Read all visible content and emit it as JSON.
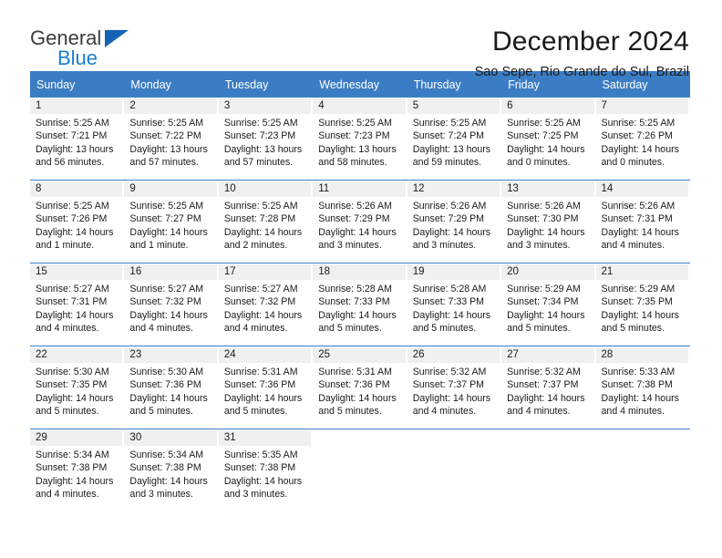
{
  "brand": {
    "name_part1": "General",
    "name_part2": "Blue",
    "triangle_color": "#1464b4",
    "blue_color": "#1a7fd4"
  },
  "header": {
    "title": "December 2024",
    "location": "Sao Sepe, Rio Grande do Sul, Brazil"
  },
  "theme": {
    "header_row_bg": "#3b7dc4",
    "daynum_band_bg": "#f0f0f0",
    "row_separator": "#3b7dc4",
    "text_color": "#1a1a1a"
  },
  "weekdays": [
    "Sunday",
    "Monday",
    "Tuesday",
    "Wednesday",
    "Thursday",
    "Friday",
    "Saturday"
  ],
  "labels": {
    "sunrise_prefix": "Sunrise:",
    "sunset_prefix": "Sunset:",
    "daylight_prefix": "Daylight:"
  },
  "weeks": [
    [
      {
        "day": "1",
        "sunrise": "Sunrise: 5:25 AM",
        "sunset": "Sunset: 7:21 PM",
        "daylight_line1": "Daylight: 13 hours",
        "daylight_line2": "and 56 minutes."
      },
      {
        "day": "2",
        "sunrise": "Sunrise: 5:25 AM",
        "sunset": "Sunset: 7:22 PM",
        "daylight_line1": "Daylight: 13 hours",
        "daylight_line2": "and 57 minutes."
      },
      {
        "day": "3",
        "sunrise": "Sunrise: 5:25 AM",
        "sunset": "Sunset: 7:23 PM",
        "daylight_line1": "Daylight: 13 hours",
        "daylight_line2": "and 57 minutes."
      },
      {
        "day": "4",
        "sunrise": "Sunrise: 5:25 AM",
        "sunset": "Sunset: 7:23 PM",
        "daylight_line1": "Daylight: 13 hours",
        "daylight_line2": "and 58 minutes."
      },
      {
        "day": "5",
        "sunrise": "Sunrise: 5:25 AM",
        "sunset": "Sunset: 7:24 PM",
        "daylight_line1": "Daylight: 13 hours",
        "daylight_line2": "and 59 minutes."
      },
      {
        "day": "6",
        "sunrise": "Sunrise: 5:25 AM",
        "sunset": "Sunset: 7:25 PM",
        "daylight_line1": "Daylight: 14 hours",
        "daylight_line2": "and 0 minutes."
      },
      {
        "day": "7",
        "sunrise": "Sunrise: 5:25 AM",
        "sunset": "Sunset: 7:26 PM",
        "daylight_line1": "Daylight: 14 hours",
        "daylight_line2": "and 0 minutes."
      }
    ],
    [
      {
        "day": "8",
        "sunrise": "Sunrise: 5:25 AM",
        "sunset": "Sunset: 7:26 PM",
        "daylight_line1": "Daylight: 14 hours",
        "daylight_line2": "and 1 minute."
      },
      {
        "day": "9",
        "sunrise": "Sunrise: 5:25 AM",
        "sunset": "Sunset: 7:27 PM",
        "daylight_line1": "Daylight: 14 hours",
        "daylight_line2": "and 1 minute."
      },
      {
        "day": "10",
        "sunrise": "Sunrise: 5:25 AM",
        "sunset": "Sunset: 7:28 PM",
        "daylight_line1": "Daylight: 14 hours",
        "daylight_line2": "and 2 minutes."
      },
      {
        "day": "11",
        "sunrise": "Sunrise: 5:26 AM",
        "sunset": "Sunset: 7:29 PM",
        "daylight_line1": "Daylight: 14 hours",
        "daylight_line2": "and 3 minutes."
      },
      {
        "day": "12",
        "sunrise": "Sunrise: 5:26 AM",
        "sunset": "Sunset: 7:29 PM",
        "daylight_line1": "Daylight: 14 hours",
        "daylight_line2": "and 3 minutes."
      },
      {
        "day": "13",
        "sunrise": "Sunrise: 5:26 AM",
        "sunset": "Sunset: 7:30 PM",
        "daylight_line1": "Daylight: 14 hours",
        "daylight_line2": "and 3 minutes."
      },
      {
        "day": "14",
        "sunrise": "Sunrise: 5:26 AM",
        "sunset": "Sunset: 7:31 PM",
        "daylight_line1": "Daylight: 14 hours",
        "daylight_line2": "and 4 minutes."
      }
    ],
    [
      {
        "day": "15",
        "sunrise": "Sunrise: 5:27 AM",
        "sunset": "Sunset: 7:31 PM",
        "daylight_line1": "Daylight: 14 hours",
        "daylight_line2": "and 4 minutes."
      },
      {
        "day": "16",
        "sunrise": "Sunrise: 5:27 AM",
        "sunset": "Sunset: 7:32 PM",
        "daylight_line1": "Daylight: 14 hours",
        "daylight_line2": "and 4 minutes."
      },
      {
        "day": "17",
        "sunrise": "Sunrise: 5:27 AM",
        "sunset": "Sunset: 7:32 PM",
        "daylight_line1": "Daylight: 14 hours",
        "daylight_line2": "and 4 minutes."
      },
      {
        "day": "18",
        "sunrise": "Sunrise: 5:28 AM",
        "sunset": "Sunset: 7:33 PM",
        "daylight_line1": "Daylight: 14 hours",
        "daylight_line2": "and 5 minutes."
      },
      {
        "day": "19",
        "sunrise": "Sunrise: 5:28 AM",
        "sunset": "Sunset: 7:33 PM",
        "daylight_line1": "Daylight: 14 hours",
        "daylight_line2": "and 5 minutes."
      },
      {
        "day": "20",
        "sunrise": "Sunrise: 5:29 AM",
        "sunset": "Sunset: 7:34 PM",
        "daylight_line1": "Daylight: 14 hours",
        "daylight_line2": "and 5 minutes."
      },
      {
        "day": "21",
        "sunrise": "Sunrise: 5:29 AM",
        "sunset": "Sunset: 7:35 PM",
        "daylight_line1": "Daylight: 14 hours",
        "daylight_line2": "and 5 minutes."
      }
    ],
    [
      {
        "day": "22",
        "sunrise": "Sunrise: 5:30 AM",
        "sunset": "Sunset: 7:35 PM",
        "daylight_line1": "Daylight: 14 hours",
        "daylight_line2": "and 5 minutes."
      },
      {
        "day": "23",
        "sunrise": "Sunrise: 5:30 AM",
        "sunset": "Sunset: 7:36 PM",
        "daylight_line1": "Daylight: 14 hours",
        "daylight_line2": "and 5 minutes."
      },
      {
        "day": "24",
        "sunrise": "Sunrise: 5:31 AM",
        "sunset": "Sunset: 7:36 PM",
        "daylight_line1": "Daylight: 14 hours",
        "daylight_line2": "and 5 minutes."
      },
      {
        "day": "25",
        "sunrise": "Sunrise: 5:31 AM",
        "sunset": "Sunset: 7:36 PM",
        "daylight_line1": "Daylight: 14 hours",
        "daylight_line2": "and 5 minutes."
      },
      {
        "day": "26",
        "sunrise": "Sunrise: 5:32 AM",
        "sunset": "Sunset: 7:37 PM",
        "daylight_line1": "Daylight: 14 hours",
        "daylight_line2": "and 4 minutes."
      },
      {
        "day": "27",
        "sunrise": "Sunrise: 5:32 AM",
        "sunset": "Sunset: 7:37 PM",
        "daylight_line1": "Daylight: 14 hours",
        "daylight_line2": "and 4 minutes."
      },
      {
        "day": "28",
        "sunrise": "Sunrise: 5:33 AM",
        "sunset": "Sunset: 7:38 PM",
        "daylight_line1": "Daylight: 14 hours",
        "daylight_line2": "and 4 minutes."
      }
    ],
    [
      {
        "day": "29",
        "sunrise": "Sunrise: 5:34 AM",
        "sunset": "Sunset: 7:38 PM",
        "daylight_line1": "Daylight: 14 hours",
        "daylight_line2": "and 4 minutes."
      },
      {
        "day": "30",
        "sunrise": "Sunrise: 5:34 AM",
        "sunset": "Sunset: 7:38 PM",
        "daylight_line1": "Daylight: 14 hours",
        "daylight_line2": "and 3 minutes."
      },
      {
        "day": "31",
        "sunrise": "Sunrise: 5:35 AM",
        "sunset": "Sunset: 7:38 PM",
        "daylight_line1": "Daylight: 14 hours",
        "daylight_line2": "and 3 minutes."
      },
      {
        "day": "",
        "sunrise": "",
        "sunset": "",
        "daylight_line1": "",
        "daylight_line2": ""
      },
      {
        "day": "",
        "sunrise": "",
        "sunset": "",
        "daylight_line1": "",
        "daylight_line2": ""
      },
      {
        "day": "",
        "sunrise": "",
        "sunset": "",
        "daylight_line1": "",
        "daylight_line2": ""
      },
      {
        "day": "",
        "sunrise": "",
        "sunset": "",
        "daylight_line1": "",
        "daylight_line2": ""
      }
    ]
  ]
}
